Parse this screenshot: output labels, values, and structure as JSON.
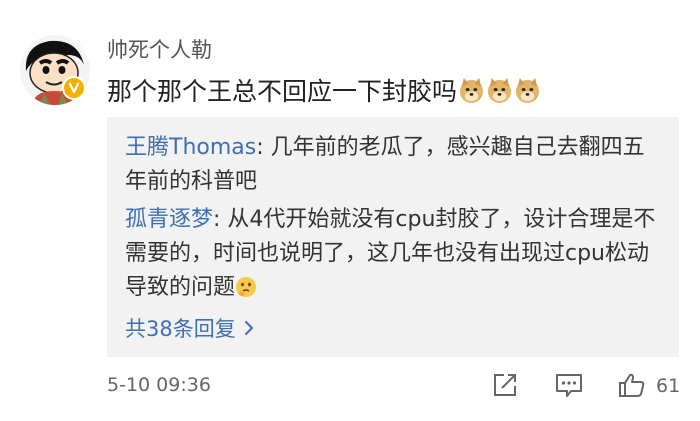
{
  "post": {
    "username": "帅死个人勒",
    "comment_text": "那个那个王总不回应一下封胶吗",
    "emojis": [
      "doge-emoji",
      "doge-emoji",
      "doge-emoji"
    ]
  },
  "replies": [
    {
      "author": "王腾Thomas",
      "separator": ": ",
      "text": "几年前的老瓜了，感兴趣自己去翻四五年前的科普吧"
    },
    {
      "author": "孤青逐梦",
      "separator": ": ",
      "text": "从4代开始就没有cpu封胶了，设计合理是不需要的，时间也说明了，这几年也没有出现过cpu松动导致的问题",
      "trailing_emoji": "thinking-emoji"
    }
  ],
  "more_replies_label": "共38条回复",
  "footer": {
    "timestamp": "5-10 09:36",
    "like_count": "61",
    "icons": [
      "share-icon",
      "comment-icon",
      "like-icon"
    ]
  },
  "colors": {
    "link_blue": "#3d6fb2",
    "reply_bg": "#f2f2f2",
    "badge_gold": "#f5b100"
  }
}
